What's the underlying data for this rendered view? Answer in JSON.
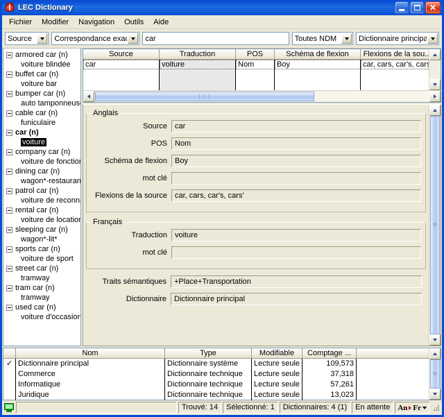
{
  "window": {
    "title": "LEC Dictionary",
    "icon": "app-logo-icon",
    "minimize_label": "Minimize",
    "maximize_label": "Maximize",
    "close_label": "Close"
  },
  "menu": {
    "items": [
      "Fichier",
      "Modifier",
      "Navigation",
      "Outils",
      "Aide"
    ]
  },
  "toolbar": {
    "field_select": "Source",
    "match_select": "Correspondance exac",
    "search_value": "car",
    "scope_select": "Toutes NDM",
    "dictionary_select": "Dictionnaire principal"
  },
  "tree": {
    "items": [
      {
        "parent": "armored car (n)",
        "child": "voiture blindée",
        "selected": false
      },
      {
        "parent": "buffet car (n)",
        "child": "voiture bar",
        "selected": false
      },
      {
        "parent": "bumper car (n)",
        "child": "auto tamponneuse",
        "selected": false
      },
      {
        "parent": "cable car (n)",
        "child": "funiculaire",
        "selected": false
      },
      {
        "parent": "car (n)",
        "child": "voiture",
        "selected": true
      },
      {
        "parent": "company car (n)",
        "child": "voiture de fonction",
        "selected": false
      },
      {
        "parent": "dining car (n)",
        "child": "wagon*-restaurant*",
        "selected": false
      },
      {
        "parent": "patrol car (n)",
        "child": "voiture de reconnais",
        "selected": false
      },
      {
        "parent": "rental car (n)",
        "child": "voiture de location",
        "selected": false
      },
      {
        "parent": "sleeping car (n)",
        "child": "wagon*-lit*",
        "selected": false
      },
      {
        "parent": "sports car (n)",
        "child": "voiture de sport",
        "selected": false
      },
      {
        "parent": "street car (n)",
        "child": "tramway",
        "selected": false
      },
      {
        "parent": "tram car (n)",
        "child": "tramway",
        "selected": false
      },
      {
        "parent": "used car (n)",
        "child": "voiture d'occasion",
        "selected": false
      }
    ]
  },
  "results_grid": {
    "headers": [
      "Source",
      "Traduction",
      "POS",
      "Schéma de flexion",
      "Flexions de la sou..."
    ],
    "rows": [
      [
        "car",
        "voiture",
        "Nom",
        "Boy",
        "car, cars, car's, cars'"
      ]
    ]
  },
  "form": {
    "english_group": "Anglais",
    "english_fields": [
      {
        "label": "Source",
        "value": "car"
      },
      {
        "label": "POS",
        "value": "Nom"
      },
      {
        "label": "Schéma de flexion",
        "value": "Boy"
      },
      {
        "label": "mot clé",
        "value": ""
      },
      {
        "label": "Flexions de la source",
        "value": "car, cars, car's, cars'"
      }
    ],
    "french_group": "Français",
    "french_fields": [
      {
        "label": "Traduction",
        "value": "voiture"
      },
      {
        "label": "mot clé",
        "value": ""
      }
    ],
    "common_fields": [
      {
        "label": "Traits sémantiques",
        "value": "+Place+Transportation"
      },
      {
        "label": "Dictionnaire",
        "value": "Dictionnaire principal"
      }
    ]
  },
  "dictionaries_table": {
    "headers": [
      "",
      "Nom",
      "Type",
      "Modifiable",
      "Comptage ...",
      ""
    ],
    "rows": [
      {
        "checked": "✓",
        "nom": "Dictionnaire principal",
        "type": "Dictionnaire système",
        "modifiable": "Lecture seule",
        "comptage": "109,573"
      },
      {
        "checked": "",
        "nom": "Commerce",
        "type": "Dictionnaire technique",
        "modifiable": "Lecture seule",
        "comptage": "37,318"
      },
      {
        "checked": "",
        "nom": "Informatique",
        "type": "Dictionnaire technique",
        "modifiable": "Lecture seule",
        "comptage": "57,261"
      },
      {
        "checked": "",
        "nom": "Juridique",
        "type": "Dictionnaire technique",
        "modifiable": "Lecture seule",
        "comptage": "13,023"
      }
    ]
  },
  "statusbar": {
    "icon": "monitor-icon",
    "message": "",
    "found": "Trouvé: 14",
    "selected": "Sélectionné: 1",
    "dictionaries": "Dictionnaires: 4 (1)",
    "state": "En attente",
    "lang_from": "An",
    "lang_to": "Fr"
  },
  "colors": {
    "titlebar": "#0a4bd4",
    "face": "#ece9d8",
    "selection": "#000000",
    "scroll_thumb": "#b0c8ef"
  }
}
